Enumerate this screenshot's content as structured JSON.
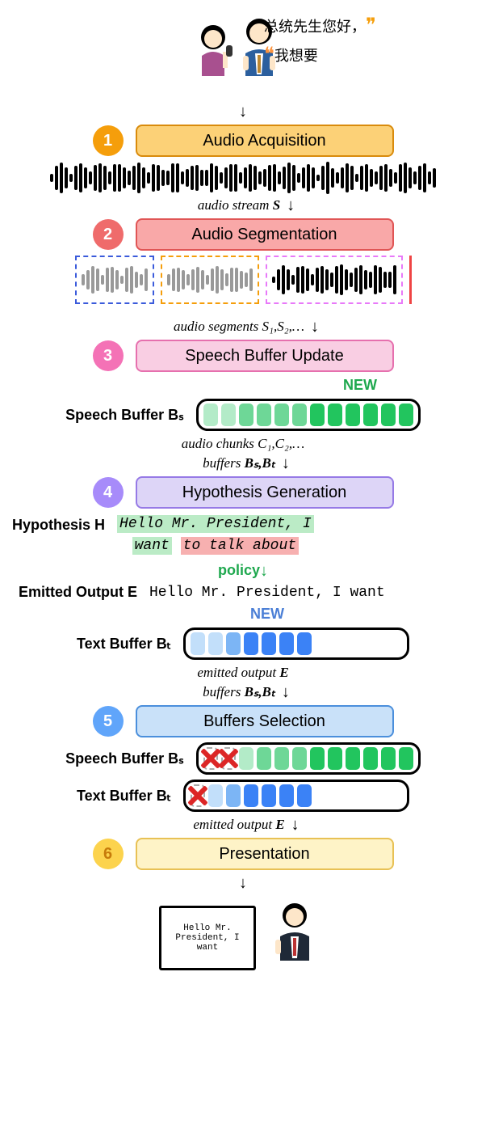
{
  "speech": {
    "line1": "总统先生您好，",
    "line2": "我想要"
  },
  "steps": {
    "1": {
      "num": "1",
      "label": "Audio Acquisition",
      "circleBg": "#f59e0b",
      "blockBg": "#fcd177",
      "blockBorder": "#d98b0c"
    },
    "2": {
      "num": "2",
      "label": "Audio Segmentation",
      "circleBg": "#ef6b6b",
      "blockBg": "#f9a8a8",
      "blockBorder": "#e05555"
    },
    "3": {
      "num": "3",
      "label": "Speech Buffer Update",
      "circleBg": "#f472b6",
      "blockBg": "#f9cee3",
      "blockBorder": "#e670ae"
    },
    "4": {
      "num": "4",
      "label": "Hypothesis Generation",
      "circleBg": "#a78bfa",
      "blockBg": "#ddd5f7",
      "blockBorder": "#967ae6"
    },
    "5": {
      "num": "5",
      "label": "Buffers Selection",
      "circleBg": "#60a5fa",
      "blockBg": "#c9e1f9",
      "blockBorder": "#4b8fdc"
    },
    "6": {
      "num": "6",
      "label": "Presentation",
      "circleBg": "#fcd34d",
      "blockBg": "#fef3c7",
      "blockBorder": "#e8c155"
    }
  },
  "arrows": {
    "audioStream": "audio stream",
    "S": "S",
    "audioSegments_pre": "audio segments ",
    "audioSegments_sym": "S₁,S₂,…",
    "audioChunks_pre": "audio chunks ",
    "audioChunks_sym": "C₁,C₂,…",
    "buffers_pre": "buffers ",
    "buffers_sym": "Bₛ,Bₜ",
    "emitted_pre": "emitted output ",
    "emitted_sym": "E",
    "policy": "policy"
  },
  "labels": {
    "new": "NEW",
    "speechBuffer_pre": "Speech Buffer ",
    "speechBuffer_sym": "Bₛ",
    "textBuffer_pre": "Text Buffer ",
    "textBuffer_sym": "Bₜ",
    "hypothesis_pre": "Hypothesis ",
    "hypothesis_sym": "H",
    "emittedOut_pre": "Emitted Output ",
    "emittedOut_sym": "E"
  },
  "hypothesis": {
    "part1": "Hello Mr. President, I",
    "part2": "want",
    "part3": "to talk about"
  },
  "emitted": "Hello Mr. President, I want",
  "screenText": "Hello Mr. President, I want",
  "colors": {
    "greenDark": "#22c55e",
    "greenMid": "#6ed797",
    "greenLight": "#b3ebc8",
    "blueDark": "#3b82f6",
    "blueMid": "#7cb5f5",
    "blueLight": "#c2dffa"
  }
}
